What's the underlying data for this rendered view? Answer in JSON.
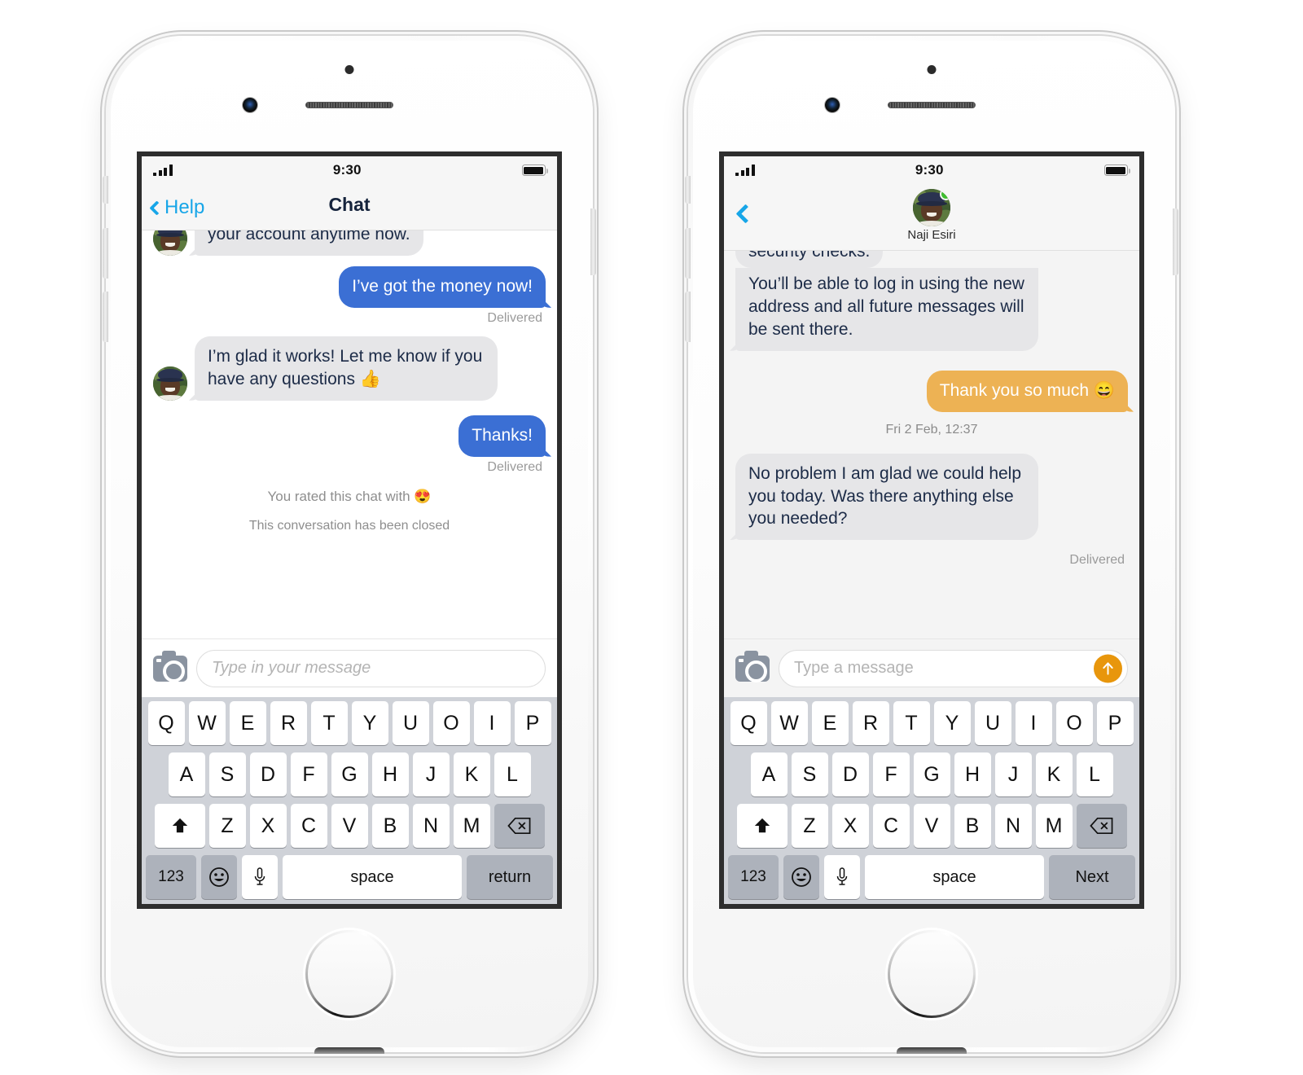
{
  "left_phone": {
    "status": {
      "time": "9:30",
      "signal_icon": "signal-bars-icon",
      "battery_icon": "battery-full-icon"
    },
    "nav": {
      "back_label": "Help",
      "title": "Chat",
      "back_icon": "chevron-left-icon"
    },
    "messages": [
      {
        "side": "in",
        "text": "your account anytime now.",
        "clipped": true,
        "avatar": true
      },
      {
        "side": "out",
        "text": "I’ve got the money now!",
        "status": "Delivered"
      },
      {
        "side": "in",
        "text": "I’m glad it works! Let me know if you have any questions 👍",
        "avatar": true
      },
      {
        "side": "out",
        "text": "Thanks!",
        "status": "Delivered"
      }
    ],
    "system_lines": [
      "You rated this chat with 😍",
      "This conversation has been closed"
    ],
    "input": {
      "placeholder": "Type in your message",
      "camera_icon": "camera-icon"
    },
    "keyboard": {
      "row1": [
        "Q",
        "W",
        "E",
        "R",
        "T",
        "Y",
        "U",
        "O",
        "I",
        "P"
      ],
      "row2": [
        "A",
        "S",
        "D",
        "F",
        "G",
        "H",
        "J",
        "K",
        "L"
      ],
      "row3": [
        "Z",
        "X",
        "C",
        "V",
        "B",
        "N",
        "M"
      ],
      "shift_icon": "shift-arrow-icon",
      "backspace_icon": "backspace-icon",
      "numbers_label": "123",
      "emoji_icon": "smiley-icon",
      "mic_icon": "microphone-icon",
      "space_label": "space",
      "action_label": "return"
    }
  },
  "right_phone": {
    "status": {
      "time": "9:30",
      "signal_icon": "signal-bars-icon",
      "battery_icon": "battery-full-icon"
    },
    "nav": {
      "back_icon": "chevron-left-icon",
      "peer_name": "Naji Esiri",
      "online_indicator": "online-status-dot"
    },
    "messages": [
      {
        "side": "in",
        "text": "security checks.",
        "clipped": true
      },
      {
        "side": "in",
        "text": "You’ll be able to log in using the new address and all future messages will be sent there."
      },
      {
        "side": "out",
        "text": "Thank you so much 😄",
        "accent": "#edb254"
      },
      {
        "side": "in",
        "text": "No problem I am glad we could help you today. Was there anything else you needed?",
        "status": "Delivered"
      }
    ],
    "timestamp": "Fri 2 Feb, 12:37",
    "delivered_label": "Delivered",
    "input": {
      "placeholder": "Type a message",
      "camera_icon": "camera-icon",
      "send_icon": "send-arrow-up-icon",
      "send_color": "#e8960c"
    },
    "keyboard": {
      "row1": [
        "Q",
        "W",
        "E",
        "R",
        "T",
        "Y",
        "U",
        "I",
        "O",
        "P"
      ],
      "row2": [
        "A",
        "S",
        "D",
        "F",
        "G",
        "H",
        "J",
        "K",
        "L"
      ],
      "row3": [
        "Z",
        "X",
        "C",
        "V",
        "B",
        "N",
        "M"
      ],
      "shift_icon": "shift-arrow-icon",
      "backspace_icon": "backspace-icon",
      "numbers_label": "123",
      "emoji_icon": "smiley-icon",
      "mic_icon": "microphone-icon",
      "space_label": "space",
      "action_label": "Next"
    }
  },
  "colors": {
    "outgoing_blue": "#3b6fd4",
    "outgoing_amber": "#edb254",
    "incoming_gray": "#e6e6e8",
    "link_blue": "#18a6e8",
    "send_orange": "#e8960c",
    "online_green": "#3fbe30"
  }
}
